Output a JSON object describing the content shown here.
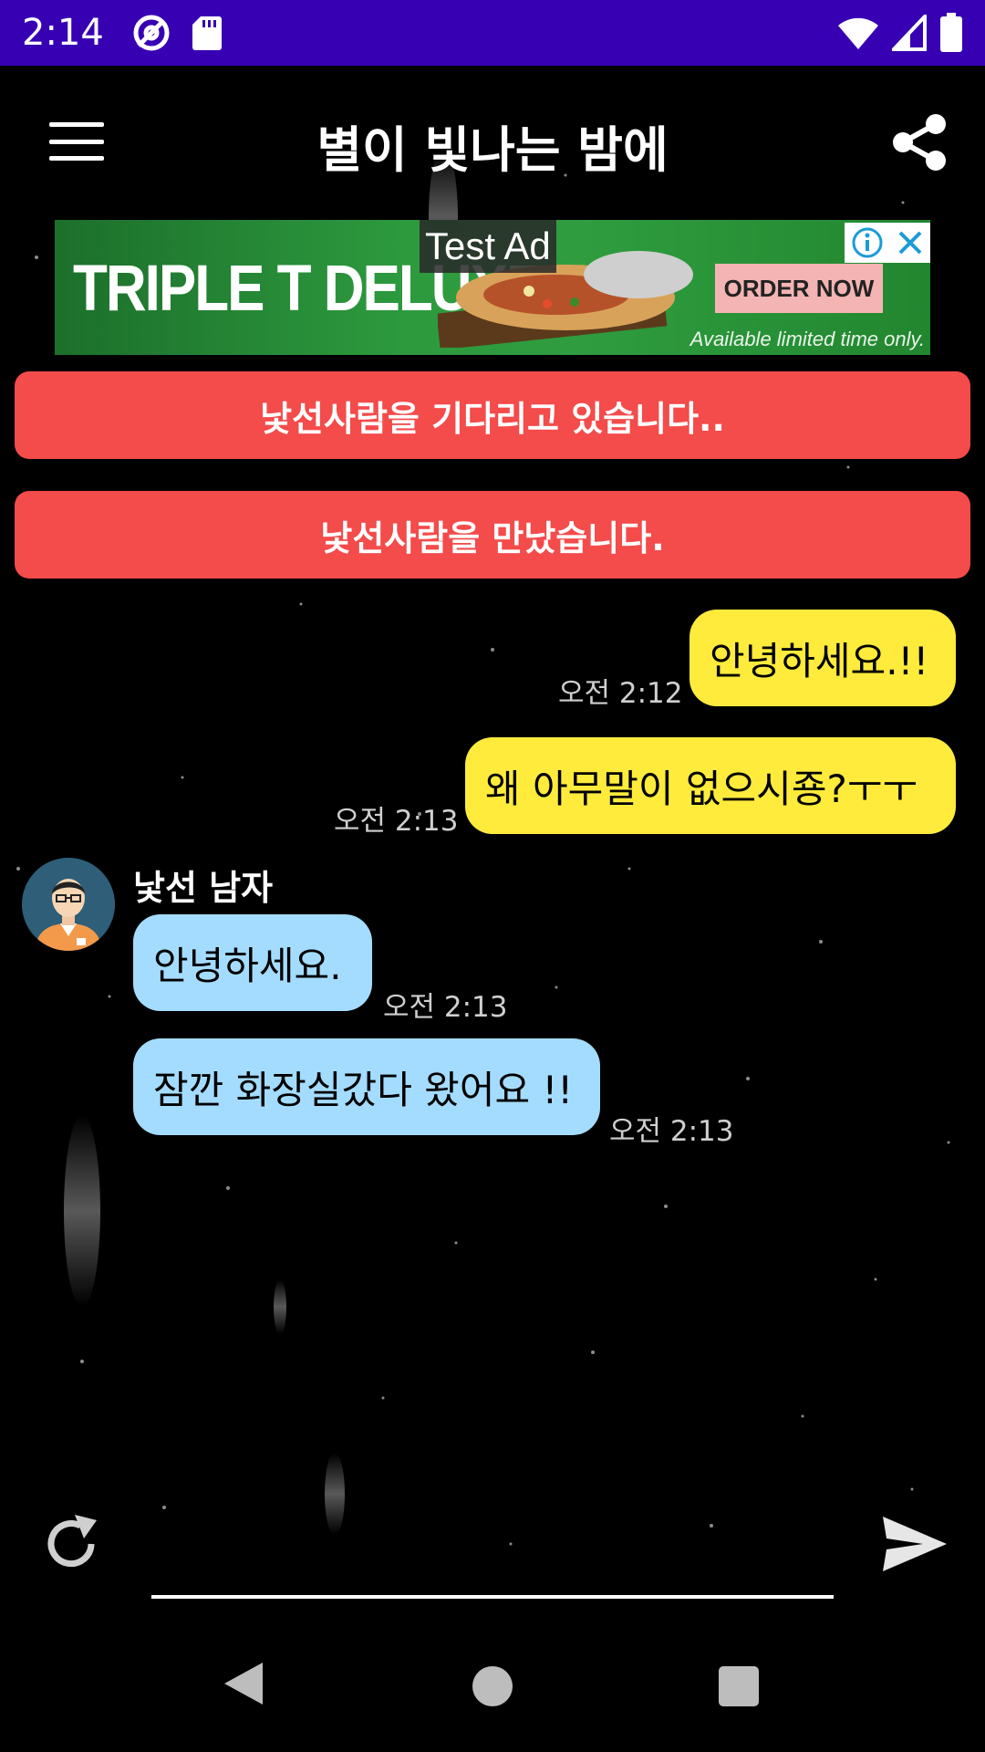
{
  "status_bar": {
    "time": "2:14",
    "icons": [
      "at-sign-icon",
      "sd-card-icon",
      "wifi-icon",
      "signal-icon",
      "battery-icon"
    ]
  },
  "app_bar": {
    "title": "별이 빛나는 밤에",
    "menu_icon": "hamburger-menu-icon",
    "share_icon": "share-icon"
  },
  "ad": {
    "label": "Test Ad",
    "brand": "TRIPLE T DELUXE",
    "cta": "ORDER NOW",
    "tagline": "Available limited time only."
  },
  "notices": [
    {
      "text": "낯선사람을 기다리고 있습니다.."
    },
    {
      "text": "낯선사람을 만났습니다."
    }
  ],
  "stranger": {
    "name": "낯선 남자"
  },
  "messages": [
    {
      "sender": "me",
      "text": "안녕하세요.!!",
      "time": "오전 2:12"
    },
    {
      "sender": "me",
      "text": "왜 아무말이 없으시죵?ㅜㅜ",
      "time": "오전 2:13"
    },
    {
      "sender": "them",
      "text": "안녕하세요.",
      "time": "오전 2:13"
    },
    {
      "sender": "them",
      "text": "잠깐 화장실갔다 왔어요 !!",
      "time": "오전 2:13"
    }
  ],
  "input": {
    "value": "",
    "placeholder": ""
  },
  "colors": {
    "status_bar": "#3700b3",
    "notice": "#f44b4b",
    "my_bubble": "#ffeb3b",
    "their_bubble": "#a4dcff"
  }
}
